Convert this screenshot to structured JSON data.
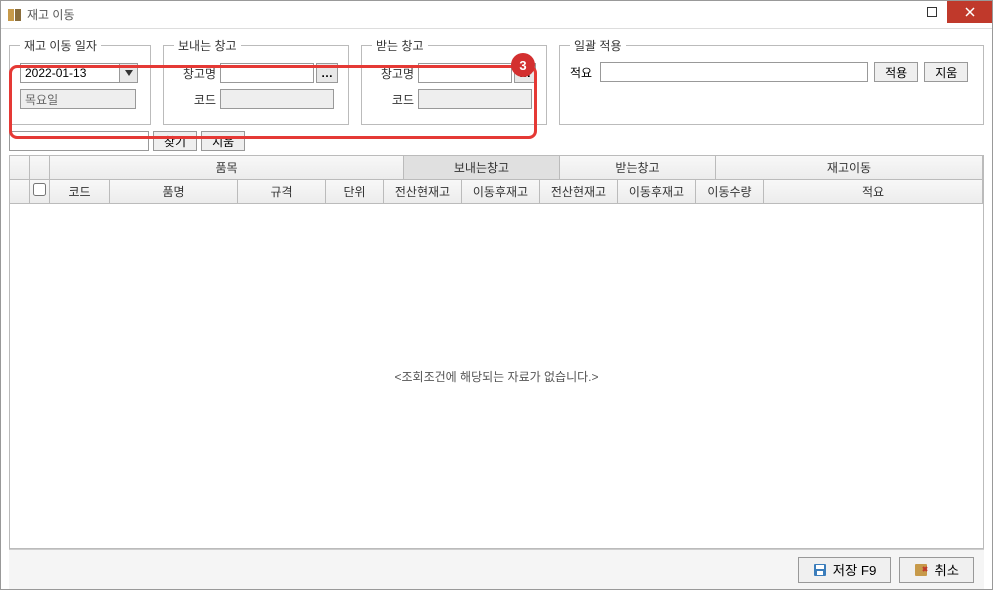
{
  "window": {
    "title": "재고 이동"
  },
  "date_group": {
    "legend": "재고 이동 일자",
    "date_value": "2022-01-13",
    "day_value": "목요일"
  },
  "send_group": {
    "legend": "보내는 창고",
    "name_label": "창고명",
    "code_label": "코드",
    "name_value": "",
    "code_value": ""
  },
  "recv_group": {
    "legend": "받는 창고",
    "name_label": "창고명",
    "code_label": "코드",
    "name_value": "",
    "code_value": ""
  },
  "batch_group": {
    "legend": "일괄 적용",
    "summary_label": "적요",
    "summary_value": "",
    "apply_label": "적용",
    "clear_label": "지움"
  },
  "search": {
    "value": "",
    "find_label": "찾기",
    "clear_label": "지움"
  },
  "grid": {
    "groups": {
      "item": "품목",
      "send": "보내는창고",
      "recv": "받는창고",
      "move": "재고이동"
    },
    "cols": {
      "code": "코드",
      "name": "품명",
      "spec": "규격",
      "unit": "단위",
      "stock1": "전산현재고",
      "after1": "이동후재고",
      "stock2": "전산현재고",
      "after2": "이동후재고",
      "qty": "이동수량",
      "memo": "적요"
    },
    "empty_message": "<조회조건에 해당되는 자료가 없습니다.>"
  },
  "footer": {
    "save_label": "저장 F9",
    "cancel_label": "취소"
  },
  "callout": {
    "num": "3"
  }
}
